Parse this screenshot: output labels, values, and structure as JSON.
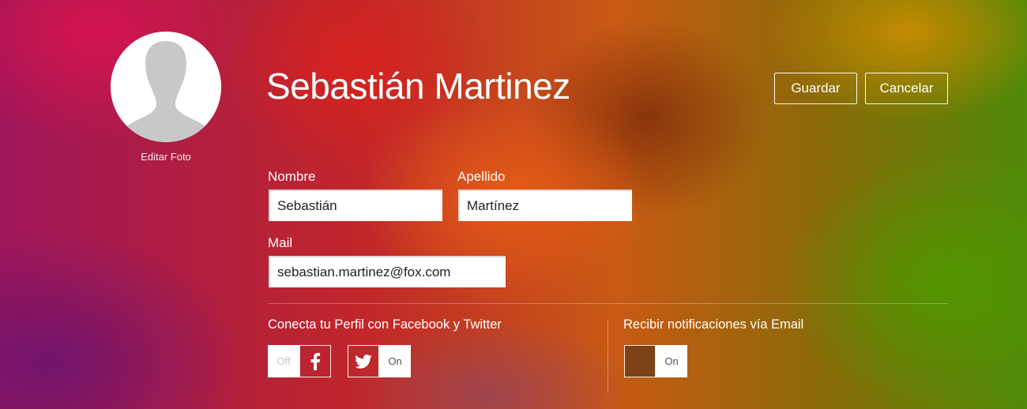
{
  "profile": {
    "name_title": "Sebastián Martinez",
    "edit_photo_label": "Editar Foto"
  },
  "actions": {
    "save_label": "Guardar",
    "cancel_label": "Cancelar"
  },
  "form": {
    "nombre_label": "Nombre",
    "nombre_value": "Sebastián",
    "apellido_label": "Apellido",
    "apellido_value": "Martínez",
    "mail_label": "Mail",
    "mail_value": "sebastian.martinez@fox.com"
  },
  "social": {
    "label": "Conecta tu Perfil con Facebook y Twitter",
    "facebook": {
      "state": "Off",
      "icon": "facebook-icon"
    },
    "twitter": {
      "state": "On",
      "icon": "twitter-icon"
    }
  },
  "notifications": {
    "label": "Recibir notificaciones vía Email",
    "email": {
      "state": "On"
    }
  },
  "colors": {
    "field_bg": "#ffffff",
    "field_text": "#222222",
    "avatar_silhouette": "#c8c8c8"
  }
}
